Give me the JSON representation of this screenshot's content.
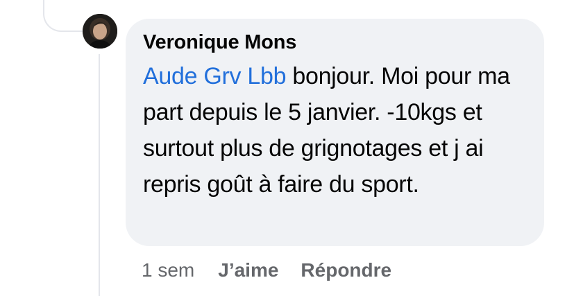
{
  "comment": {
    "author": "Veronique Mons",
    "mention": "Aude Grv Lbb",
    "text": " bonjour. Moi pour ma part depuis le 5 janvier. -10kgs et surtout plus de grignotages et j ai repris goût à faire du sport."
  },
  "actions": {
    "time": "1 sem",
    "like_label": "J’aime",
    "reply_label": "Répondre"
  },
  "colors": {
    "bubble": "#f0f2f5",
    "mention": "#216fdb",
    "meta": "#65676b"
  }
}
